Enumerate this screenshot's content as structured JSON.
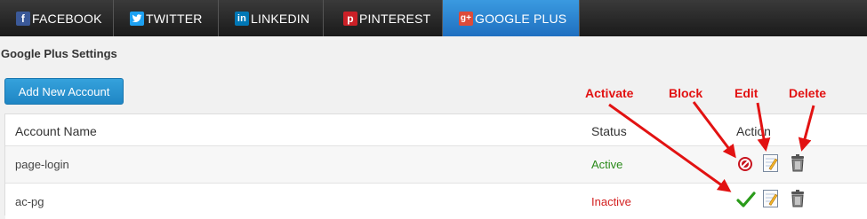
{
  "tabs": [
    {
      "label": "FACEBOOK",
      "icon": "facebook-icon",
      "color": "#3b5998"
    },
    {
      "label": "TWITTER",
      "icon": "twitter-icon",
      "color": "#1da1f2"
    },
    {
      "label": "LINKEDIN",
      "icon": "linkedin-icon",
      "color": "#0077b5"
    },
    {
      "label": "PINTEREST",
      "icon": "pinterest-icon",
      "color": "#cb2027"
    },
    {
      "label": "GOOGLE PLUS",
      "icon": "google-plus-icon",
      "color": "#dd4b39",
      "active": true
    }
  ],
  "page": {
    "title": "Google Plus Settings",
    "add_button": "Add New Account"
  },
  "table": {
    "headers": {
      "name": "Account Name",
      "status": "Status",
      "action": "Action"
    },
    "rows": [
      {
        "name": "page-login",
        "status": "Active",
        "toggle_icon": "block-icon"
      },
      {
        "name": "ac-pg",
        "status": "Inactive",
        "toggle_icon": "activate-check-icon"
      }
    ]
  },
  "annotations": {
    "activate": "Activate",
    "block": "Block",
    "edit": "Edit",
    "delete": "Delete"
  },
  "colors": {
    "annotation": "#e21212",
    "active": "#2a8a1a",
    "inactive": "#d32020",
    "accent": "#1f86c4"
  }
}
